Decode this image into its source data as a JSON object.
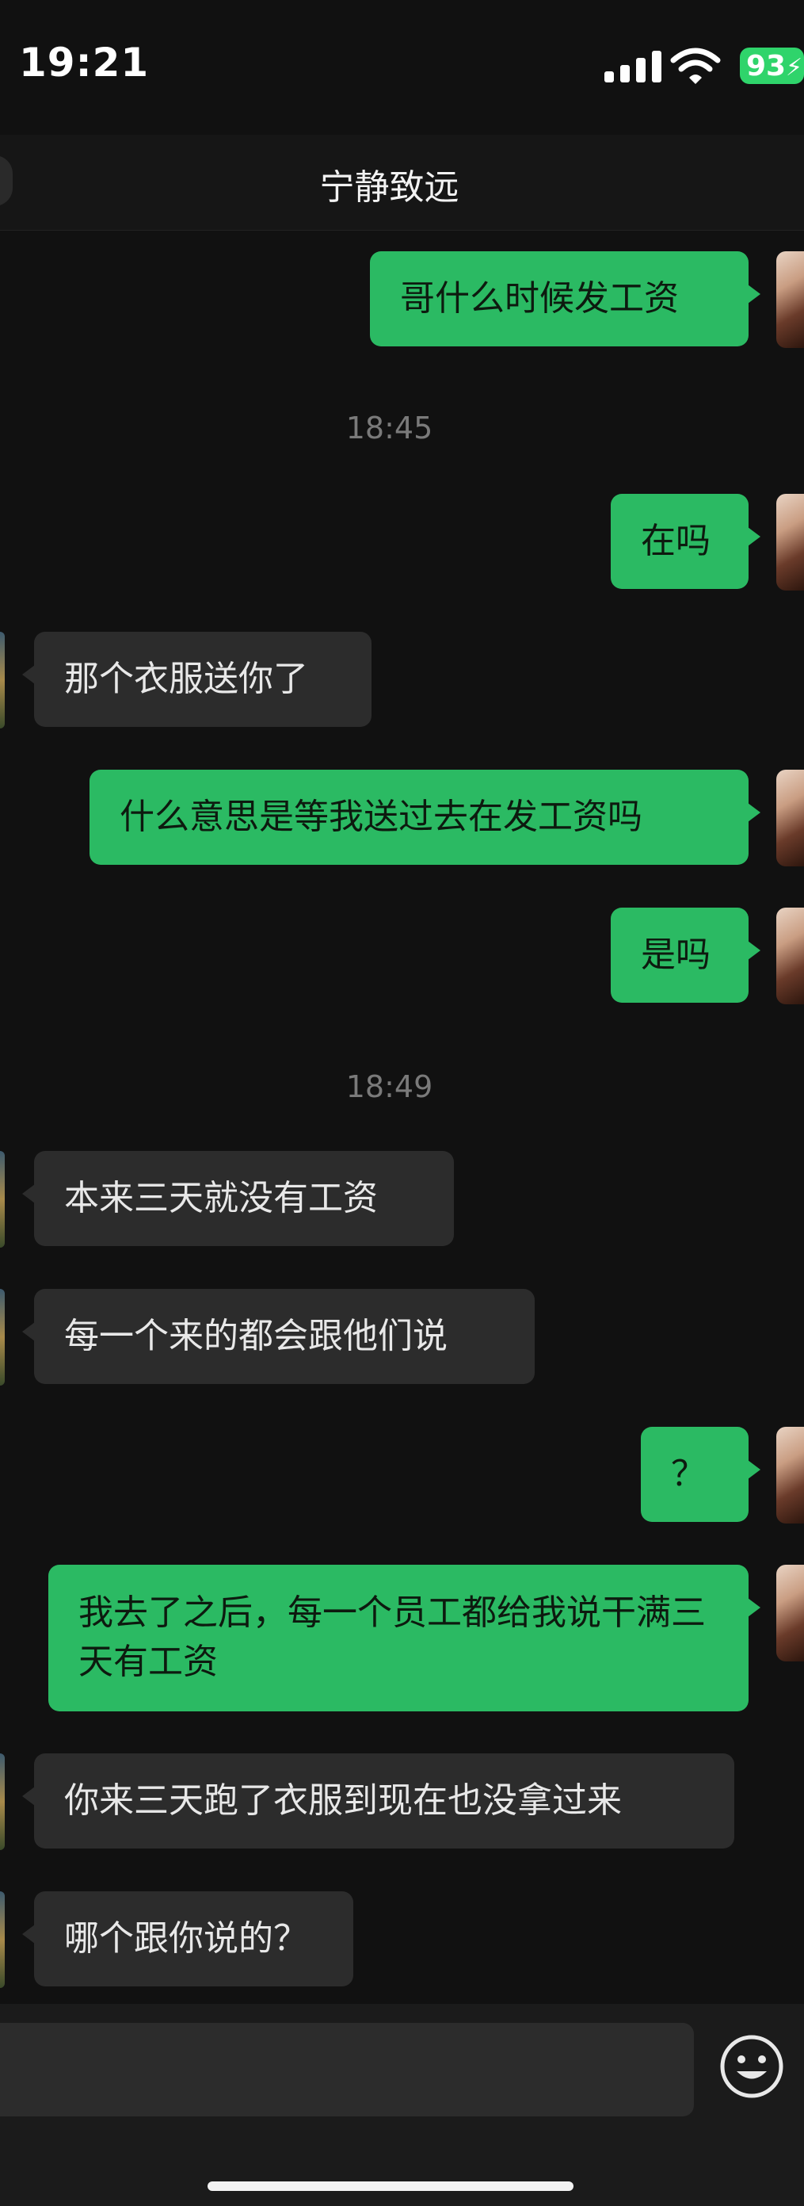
{
  "status_bar": {
    "time": "19:21",
    "battery": "93"
  },
  "nav": {
    "title": "宁静致远"
  },
  "messages": [
    {
      "type": "sent",
      "text": "哥什么时候发工资"
    },
    {
      "type": "time",
      "text": "18:45"
    },
    {
      "type": "sent",
      "text": "在吗"
    },
    {
      "type": "received",
      "text": "那个衣服送你了"
    },
    {
      "type": "sent",
      "text": "什么意思是等我送过去在发工资吗"
    },
    {
      "type": "sent",
      "text": "是吗"
    },
    {
      "type": "time",
      "text": "18:49"
    },
    {
      "type": "received",
      "text": "本来三天就没有工资"
    },
    {
      "type": "received",
      "text": "每一个来的都会跟他们说"
    },
    {
      "type": "sent",
      "text": "？"
    },
    {
      "type": "sent",
      "text": "我去了之后，每一个员工都给我说干满三天有工资"
    },
    {
      "type": "received",
      "text": "你来三天跑了衣服到现在也没拿过来"
    },
    {
      "type": "received",
      "text": "哪个跟你说的？"
    }
  ],
  "icons": {
    "emoji": "emoji-face-icon",
    "signal": "signal-icon",
    "wifi": "wifi-icon",
    "battery": "battery-icon"
  }
}
